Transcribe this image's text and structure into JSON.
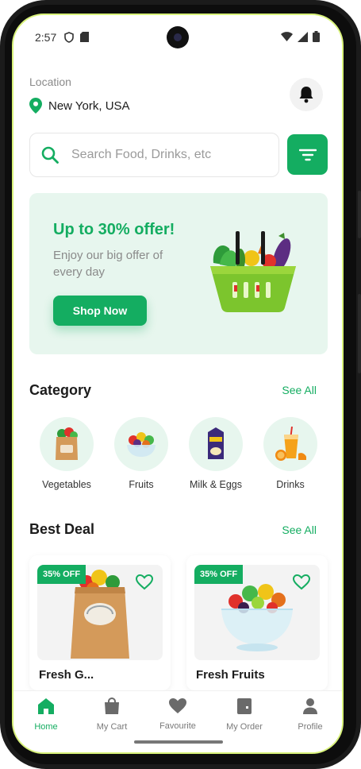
{
  "status_bar": {
    "time": "2:57"
  },
  "header": {
    "location_label": "Location",
    "location_value": "New York, USA"
  },
  "search": {
    "placeholder": "Search Food, Drinks, etc"
  },
  "promo": {
    "title": "Up to 30% offer!",
    "description": "Enjoy our big offer of every day",
    "button_label": "Shop Now"
  },
  "category": {
    "title": "Category",
    "see_all": "See All",
    "items": [
      {
        "label": "Vegetables",
        "icon": "grocery-bag-icon"
      },
      {
        "label": "Fruits",
        "icon": "fruit-bowl-icon"
      },
      {
        "label": "Milk & Eggs",
        "icon": "milk-box-icon"
      },
      {
        "label": "Drinks",
        "icon": "juice-glass-icon"
      }
    ]
  },
  "best_deal": {
    "title": "Best Deal",
    "see_all": "See All",
    "items": [
      {
        "badge": "35% OFF",
        "name": "Fresh G..."
      },
      {
        "badge": "35% OFF",
        "name": "Fresh Fruits"
      }
    ]
  },
  "nav": {
    "items": [
      {
        "label": "Home",
        "icon": "home-icon",
        "active": true
      },
      {
        "label": "My Cart",
        "icon": "shopping-bag-icon",
        "active": false
      },
      {
        "label": "Favourite",
        "icon": "heart-icon",
        "active": false
      },
      {
        "label": "My Order",
        "icon": "order-icon",
        "active": false
      },
      {
        "label": "Profile",
        "icon": "profile-icon",
        "active": false
      }
    ]
  },
  "colors": {
    "accent": "#14ad61",
    "accent_light": "#e7f6ee",
    "text_primary": "#1c1c1c",
    "text_secondary": "#8a8a8a"
  }
}
